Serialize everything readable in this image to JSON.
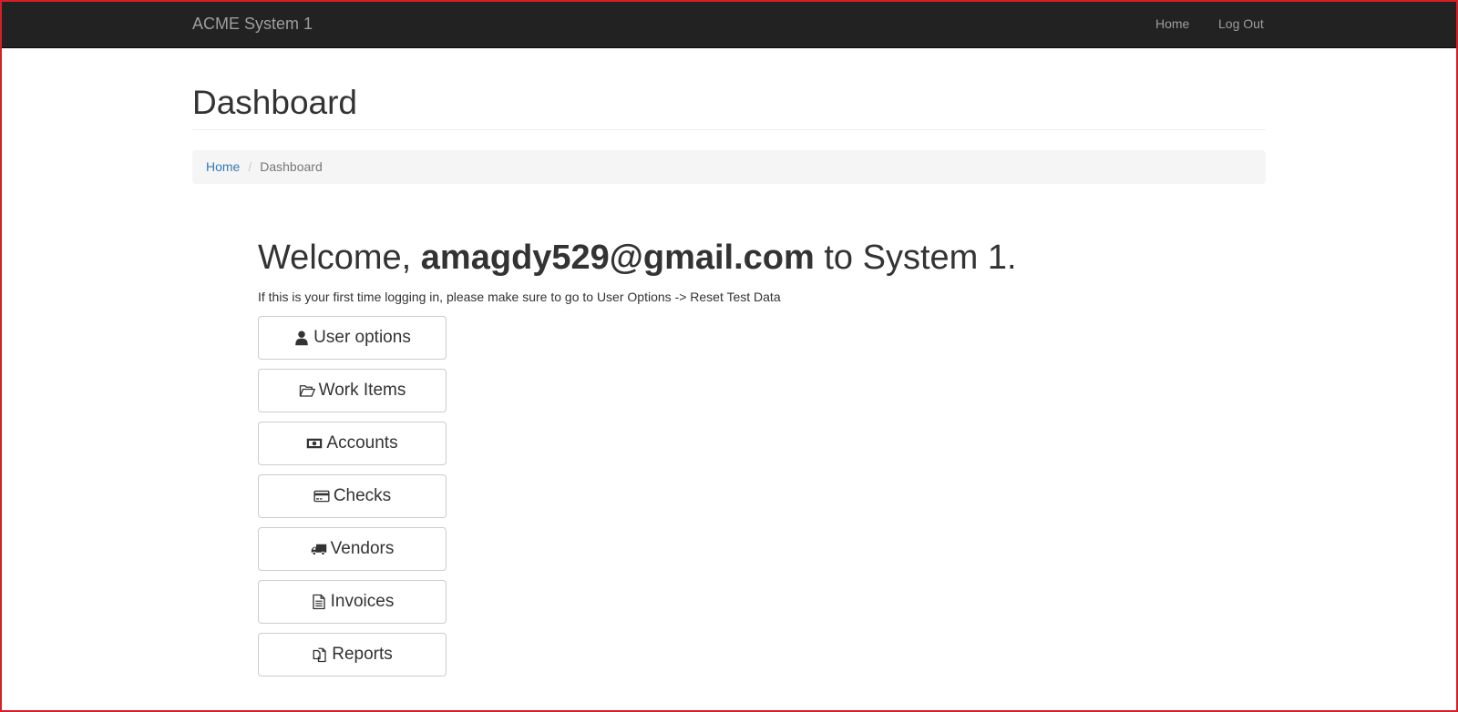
{
  "navbar": {
    "brand": "ACME System 1",
    "links": {
      "home": "Home",
      "logout": "Log Out"
    }
  },
  "page": {
    "title": "Dashboard"
  },
  "breadcrumb": {
    "home": "Home",
    "separator": "/",
    "current": "Dashboard"
  },
  "welcome": {
    "prefix": "Welcome, ",
    "email": "amagdy529@gmail.com",
    "suffix": " to System 1.",
    "info": "If this is your first time logging in, please make sure to go to User Options -> Reset Test Data"
  },
  "menu": [
    {
      "label": "User options",
      "icon": "user-icon"
    },
    {
      "label": "Work Items",
      "icon": "folder-open-icon"
    },
    {
      "label": "Accounts",
      "icon": "money-icon"
    },
    {
      "label": "Checks",
      "icon": "credit-card-icon"
    },
    {
      "label": "Vendors",
      "icon": "truck-icon"
    },
    {
      "label": "Invoices",
      "icon": "file-text-icon"
    },
    {
      "label": "Reports",
      "icon": "files-icon"
    }
  ],
  "colors": {
    "navbar_bg": "#222222",
    "navbar_text": "#9d9d9d",
    "link": "#337ab7",
    "breadcrumb_bg": "#f5f5f5",
    "frame_border": "#d61f26"
  }
}
